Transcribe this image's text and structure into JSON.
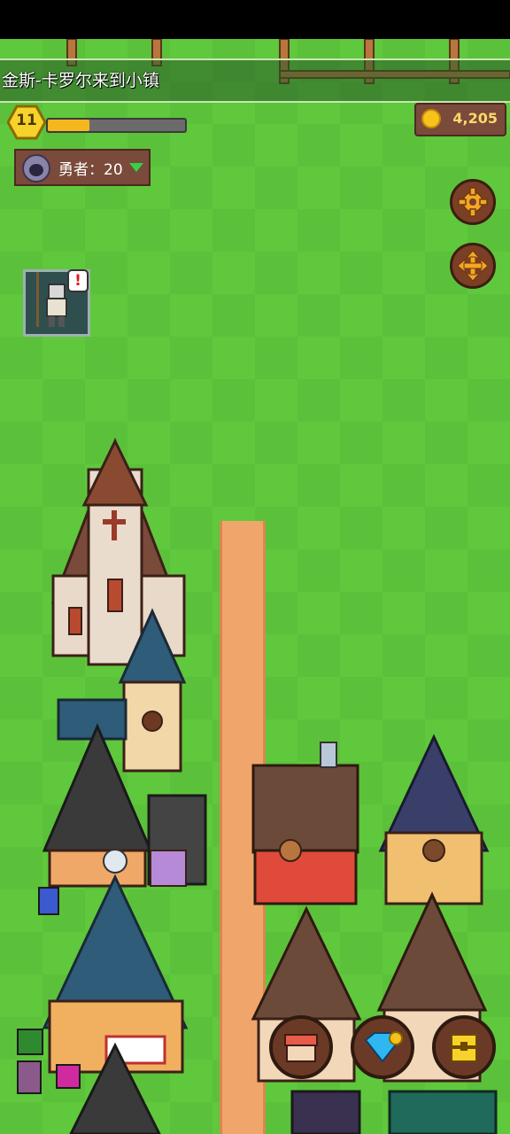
{
  "ticker": {
    "message": "金斯-卡罗尔来到小镇"
  },
  "player": {
    "level": "11",
    "xp_fraction": 0.3
  },
  "heroes": {
    "label": "勇者：20"
  },
  "currency": {
    "gold": "4,205"
  },
  "buttons": {
    "settings": "gear-icon",
    "move": "move-arrows-icon",
    "shop": "shop-icon",
    "gems": "gem-icon",
    "chest": "chest-icon"
  },
  "colors": {
    "grass": "#5fc83c",
    "road": "#f0a56a",
    "gold": "#f6c21b",
    "panel": "#7a4a3a"
  }
}
